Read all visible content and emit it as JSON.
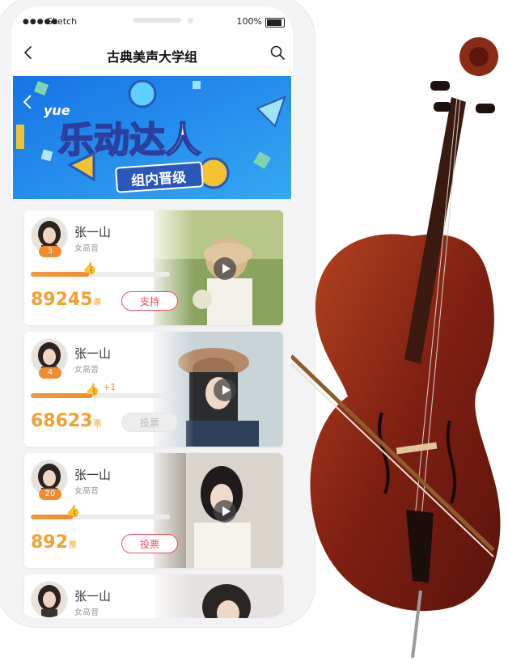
{
  "status_bar": {
    "signal": "●●●●●",
    "carrier": "Sketch",
    "battery": "100%"
  },
  "nav": {
    "title": "古典美声大学组"
  },
  "banner": {
    "logo_text": "yue",
    "headline": "乐动达人",
    "tag": "组内晋级"
  },
  "cards": [
    {
      "name": "张一山",
      "voice": "女高音",
      "rank": "3",
      "votes": "89245",
      "unit": "票",
      "button": "支持",
      "button_state": "active",
      "progress": 0.42,
      "plus": ""
    },
    {
      "name": "张一山",
      "voice": "女高音",
      "rank": "4",
      "votes": "68623",
      "unit": "票",
      "button": "投票",
      "button_state": "disabled",
      "progress": 0.44,
      "plus": "+1"
    },
    {
      "name": "张一山",
      "voice": "女高音",
      "rank": "20",
      "votes": "892",
      "unit": "票",
      "button": "投票",
      "button_state": "active",
      "progress": 0.3,
      "plus": ""
    },
    {
      "name": "张一山",
      "voice": "女高音",
      "rank": "",
      "votes": "",
      "unit": "",
      "button": "",
      "button_state": "",
      "progress": 0,
      "plus": ""
    }
  ],
  "colors": {
    "accent": "#f08b32",
    "button_red": "#ee4d5b",
    "banner_blue": "#1e8ae8",
    "votes_orange": "#f0a130"
  },
  "icons": [
    "back-arrow-icon",
    "search-icon",
    "play-icon",
    "thumbs-up-icon",
    "cello-image"
  ]
}
